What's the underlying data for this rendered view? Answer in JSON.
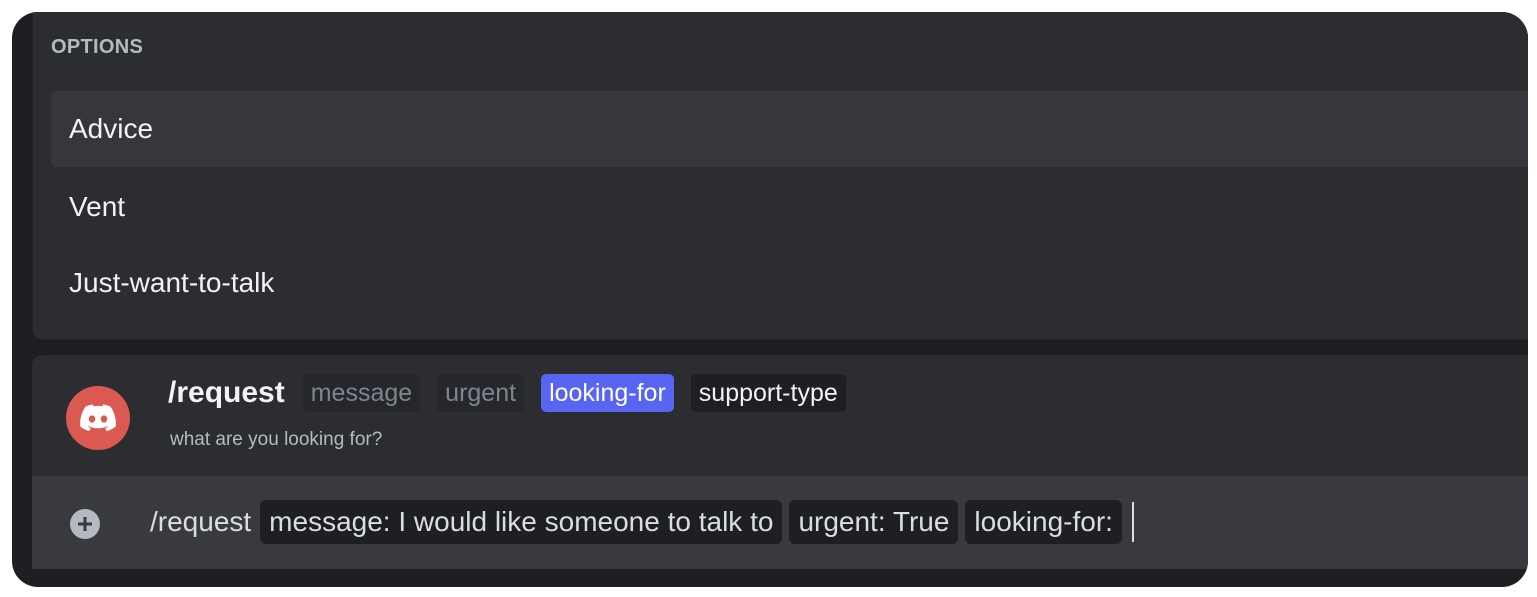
{
  "options": {
    "header": "OPTIONS",
    "items": [
      {
        "label": "Advice"
      },
      {
        "label": "Vent"
      },
      {
        "label": "Just-want-to-talk"
      }
    ]
  },
  "command": {
    "name": "/request",
    "params": [
      {
        "label": "message",
        "state": "done"
      },
      {
        "label": "urgent",
        "state": "done"
      },
      {
        "label": "looking-for",
        "state": "current"
      },
      {
        "label": "support-type",
        "state": "pending"
      }
    ],
    "description": "what are you looking for?",
    "avatar_icon": "discord-logo-icon",
    "avatar_color": "#da5a51",
    "accent_color": "#5865f2"
  },
  "input": {
    "command": "/request",
    "chips": [
      {
        "text": "message: I would like someone to talk to"
      },
      {
        "text": "urgent: True"
      },
      {
        "text": "looking-for:"
      }
    ],
    "add_icon": "plus-circle-icon"
  }
}
